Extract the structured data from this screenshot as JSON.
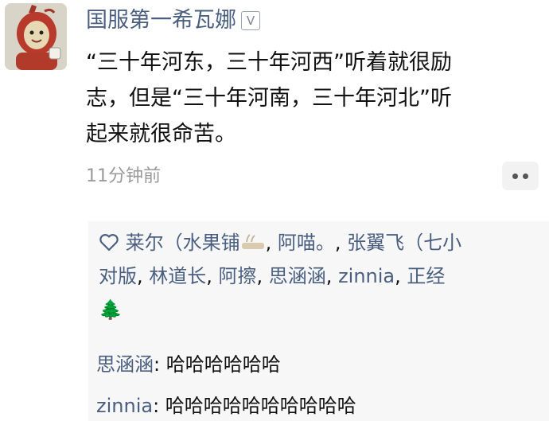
{
  "post": {
    "username": "国服第一希瓦娜",
    "verified_icon": "v-badge-icon",
    "text_lines": [
      "“三十年河东，三十年河西”听着就很励",
      "志，但是“三十年河南，三十年河北”听",
      "起来就很命苦。"
    ],
    "timestamp": "11分钟前",
    "more_icon": "more-dots-icon"
  },
  "likes": {
    "icon": "heart-outline-icon",
    "line1": {
      "n1": "莱尔（水果铺",
      "sep1": ", ",
      "n2": "阿喵。",
      "sep2": ", ",
      "n3": "张翼飞（七小"
    },
    "line2": {
      "n3b": "对版",
      "sep3": ", ",
      "n4": "林道长",
      "sep4": ", ",
      "n5": "阿擦",
      "sep5": ", ",
      "n6": "思涵涵",
      "sep6": ", ",
      "n7": "zinnia",
      "sep7": ", ",
      "n8": "正经"
    },
    "tree_emoji": "🌲"
  },
  "comments": [
    {
      "author": "思涵涵",
      "sep": ": ",
      "text": "哈哈哈哈哈哈"
    },
    {
      "author": "zinnia",
      "sep": ": ",
      "text": "哈哈哈哈哈哈哈哈哈哈"
    }
  ]
}
